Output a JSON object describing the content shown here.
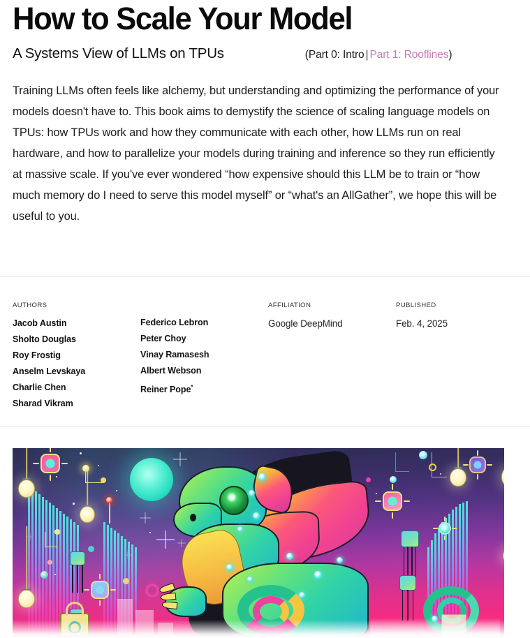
{
  "header": {
    "title": "How to Scale Your Model",
    "subtitle": "A Systems View of LLMs on TPUs",
    "nav": {
      "open_paren": "(",
      "current_part": "Part 0: Intro",
      "separator": "|",
      "next_part_link": "Part 1: Rooflines",
      "close_paren": ")",
      "link_color": "#c479b4"
    }
  },
  "intro": {
    "paragraph": "Training LLMs often feels like alchemy, but understanding and optimizing the performance of your models doesn't have to. This book aims to demystify the science of scaling language models on TPUs: how TPUs work and how they communicate with each other, how LLMs run on real hardware, and how to parallelize your models during training and inference so they run efficiently at massive scale. If you've ever wondered “how expensive should this LLM be to train or “how much memory do I need to serve this model myself” or “what's an AllGather”, we hope this will be useful to you."
  },
  "meta": {
    "authors_label": "AUTHORS",
    "authors_column_1": [
      "Jacob Austin",
      "Sholto Douglas",
      "Roy Frostig",
      "Anselm Levskaya",
      "Charlie Chen",
      "Sharad Vikram"
    ],
    "authors_column_2": [
      "Federico Lebron",
      "Peter Choy",
      "Vinay Ramasesh",
      "Albert Webson",
      "Reiner Pope"
    ],
    "author_footnote_marker": "*",
    "affiliation_label": "AFFILIATION",
    "affiliation_value": "Google DeepMind",
    "published_label": "PUBLISHED",
    "published_value": "Feb. 4, 2025"
  },
  "hero": {
    "alt": "Neon cyberpunk illustration of a circuit-board dragon surrounded by hanging lightbulbs, glowing chips and a teal moon",
    "palette": {
      "sky_top": "#2c2a4e",
      "sky_mid": "#7b3996",
      "sky_bottom": "#f4348a",
      "moon": "#55e9cf",
      "bar_top": "#57e8e0",
      "bar_bottom": "#f5318c",
      "bulb_glass": "#fdf6c8",
      "dragon_green": "#6fe07f",
      "dragon_belly": "#f7e05c",
      "wing_pink": "#e8468e",
      "wing_yellow": "#f2e23f",
      "eye_green": "#49d16a"
    }
  }
}
